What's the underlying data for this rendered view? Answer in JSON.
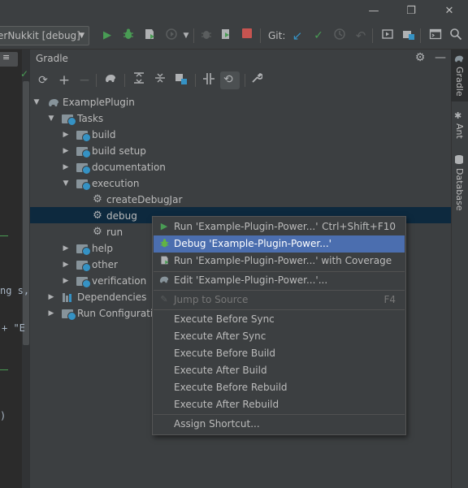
{
  "window": {
    "minimize": "—",
    "restore": "❐",
    "close": "✕"
  },
  "toolbar": {
    "run_config": "erNukkit [debug]",
    "git_label": "Git:"
  },
  "editor": {
    "line1": "ng s,",
    "line2": "+ \"E",
    "line3": ")"
  },
  "panel": {
    "title": "Gradle"
  },
  "tree": {
    "root": "ExamplePlugin",
    "tasks": "Tasks",
    "build": "build",
    "build_setup": "build setup",
    "documentation": "documentation",
    "execution": "execution",
    "createDebugJar": "createDebugJar",
    "debug": "debug",
    "run": "run",
    "help": "help",
    "other": "other",
    "verification": "verification",
    "dependencies": "Dependencies",
    "run_configurations": "Run Configuration"
  },
  "right_tabs": {
    "gradle": "Gradle",
    "ant": "Ant",
    "database": "Database"
  },
  "menu": {
    "run": "Run 'Example-Plugin-Power...'",
    "run_shortcut": "Ctrl+Shift+F10",
    "debug": "Debug 'Example-Plugin-Power...'",
    "coverage": "Run 'Example-Plugin-Power...' with Coverage",
    "edit": "Edit 'Example-Plugin-Power...'...",
    "jump": "Jump to Source",
    "jump_shortcut": "F4",
    "before_sync": "Execute Before Sync",
    "after_sync": "Execute After Sync",
    "before_build": "Execute Before Build",
    "after_build": "Execute After Build",
    "before_rebuild": "Execute Before Rebuild",
    "after_rebuild": "Execute After Rebuild",
    "assign_shortcut": "Assign Shortcut..."
  },
  "colors": {
    "background": "#3c3f41",
    "editor": "#2b2b2b",
    "selection": "#0d293e",
    "menu_highlight": "#4b6eaf",
    "run_green": "#499c54",
    "stop_red": "#c75450",
    "git_blue": "#3592c4"
  }
}
